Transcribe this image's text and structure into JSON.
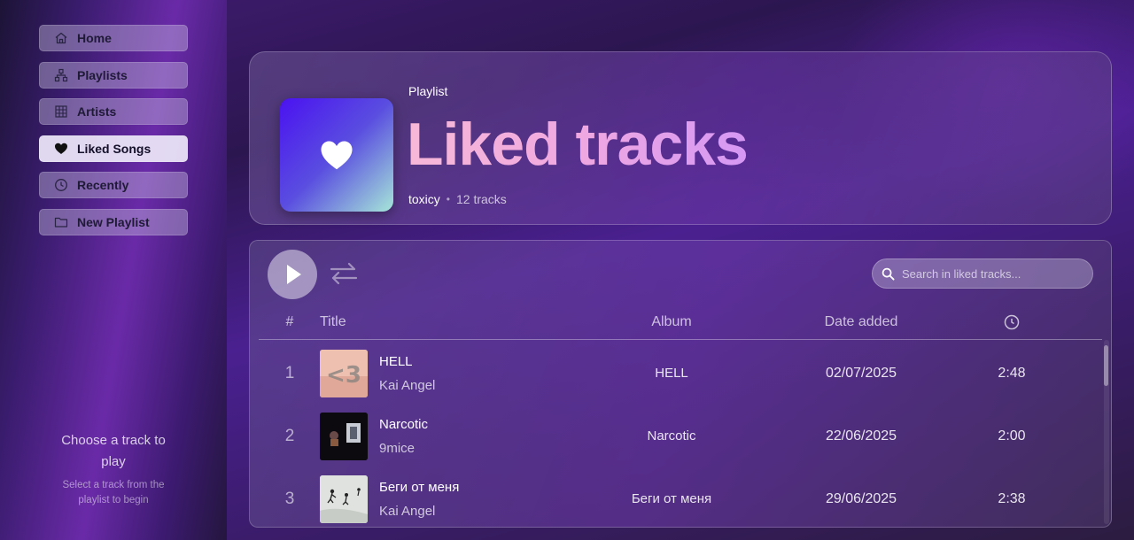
{
  "sidebar": {
    "items": [
      {
        "label": "Home",
        "icon": "home-icon",
        "active": false
      },
      {
        "label": "Playlists",
        "icon": "sitemap-icon",
        "active": false
      },
      {
        "label": "Artists",
        "icon": "grid-icon",
        "active": false
      },
      {
        "label": "Liked Songs",
        "icon": "heart-icon",
        "active": true
      },
      {
        "label": "Recently",
        "icon": "clock-icon",
        "active": false
      },
      {
        "label": "New Playlist",
        "icon": "folder-icon",
        "active": false
      }
    ],
    "hint_title": "Choose a track to play",
    "hint_subtitle": "Select a track from the playlist to begin"
  },
  "playlist": {
    "kind": "Playlist",
    "title": "Liked tracks",
    "owner": "toxicy",
    "separator": "•",
    "track_count": "12 tracks"
  },
  "controls": {
    "search_placeholder": "Search in liked tracks..."
  },
  "table": {
    "headers": {
      "num": "#",
      "title": "Title",
      "album": "Album",
      "date": "Date added",
      "duration_icon": "clock-icon"
    },
    "rows": [
      {
        "num": "1",
        "title": "HELL",
        "artist": "Kai Angel",
        "album": "HELL",
        "date": "02/07/2025",
        "duration": "2:48"
      },
      {
        "num": "2",
        "title": "Narcotic",
        "artist": "9mice",
        "album": "Narcotic",
        "date": "22/06/2025",
        "duration": "2:00"
      },
      {
        "num": "3",
        "title": "Беги от меня",
        "artist": "Kai Angel",
        "album": "Беги от меня",
        "date": "29/06/2025",
        "duration": "2:38"
      }
    ]
  },
  "colors": {
    "accent_gradient_start": "#f7b8d8",
    "accent_gradient_end": "#d598f4",
    "cover_gradient_start": "#4a12f0",
    "cover_gradient_end": "#a6e6d8"
  }
}
